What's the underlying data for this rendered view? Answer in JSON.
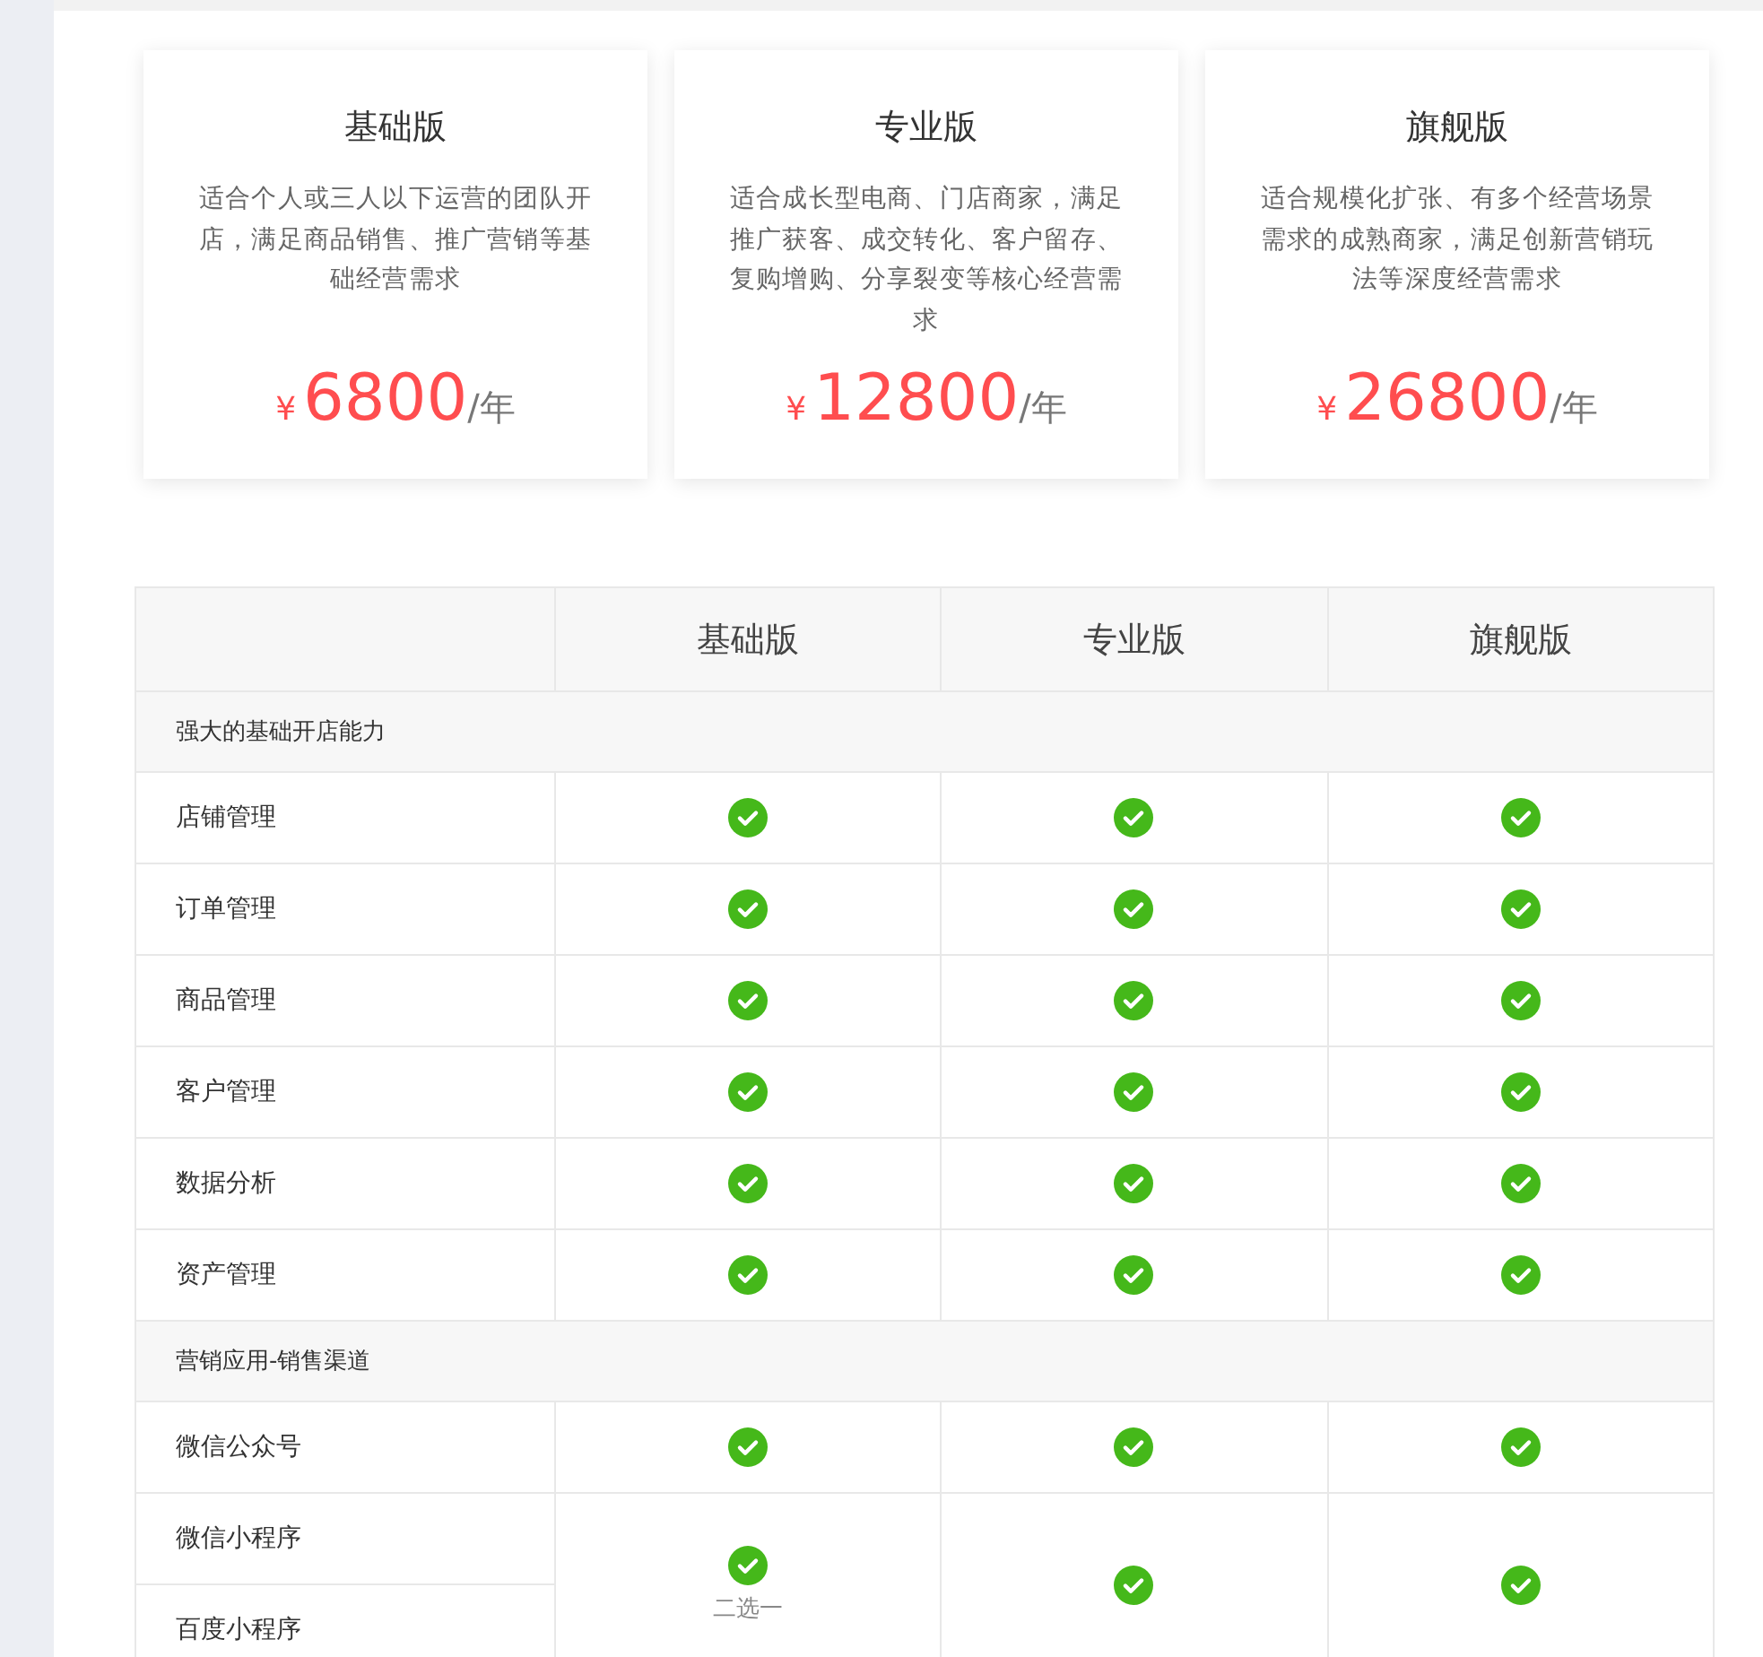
{
  "plans": [
    {
      "title": "基础版",
      "description": "适合个人或三人以下运营的团队开店，满足商品销售、推广营销等基础经营需求",
      "currency": "¥",
      "price": "6800",
      "unit": "/年"
    },
    {
      "title": "专业版",
      "description": "适合成长型电商、门店商家，满足推广获客、成交转化、客户留存、复购增购、分享裂变等核心经营需求",
      "currency": "¥",
      "price": "12800",
      "unit": "/年"
    },
    {
      "title": "旗舰版",
      "description": "适合规模化扩张、有多个经营场景需求的成熟商家，满足创新营销玩法等深度经营需求",
      "currency": "¥",
      "price": "26800",
      "unit": "/年"
    }
  ],
  "comparison": {
    "columns": [
      "基础版",
      "专业版",
      "旗舰版"
    ],
    "sections": [
      {
        "title": "强大的基础开店能力",
        "rows": [
          {
            "kind": "single",
            "names": [
              "店铺管理"
            ],
            "cells": [
              {
                "included": true
              },
              {
                "included": true
              },
              {
                "included": true
              }
            ]
          },
          {
            "kind": "single",
            "names": [
              "订单管理"
            ],
            "cells": [
              {
                "included": true
              },
              {
                "included": true
              },
              {
                "included": true
              }
            ]
          },
          {
            "kind": "single",
            "names": [
              "商品管理"
            ],
            "cells": [
              {
                "included": true
              },
              {
                "included": true
              },
              {
                "included": true
              }
            ]
          },
          {
            "kind": "single",
            "names": [
              "客户管理"
            ],
            "cells": [
              {
                "included": true
              },
              {
                "included": true
              },
              {
                "included": true
              }
            ]
          },
          {
            "kind": "single",
            "names": [
              "数据分析"
            ],
            "cells": [
              {
                "included": true
              },
              {
                "included": true
              },
              {
                "included": true
              }
            ]
          },
          {
            "kind": "single",
            "names": [
              "资产管理"
            ],
            "cells": [
              {
                "included": true
              },
              {
                "included": true
              },
              {
                "included": true
              }
            ]
          }
        ]
      },
      {
        "title": "营销应用-销售渠道",
        "rows": [
          {
            "kind": "single",
            "names": [
              "微信公众号"
            ],
            "cells": [
              {
                "included": true
              },
              {
                "included": true
              },
              {
                "included": true
              }
            ]
          },
          {
            "kind": "merged",
            "names": [
              "微信小程序",
              "百度小程序"
            ],
            "cells": [
              {
                "included": true,
                "note": "二选一"
              },
              {
                "included": true
              },
              {
                "included": true
              }
            ]
          }
        ]
      }
    ]
  }
}
